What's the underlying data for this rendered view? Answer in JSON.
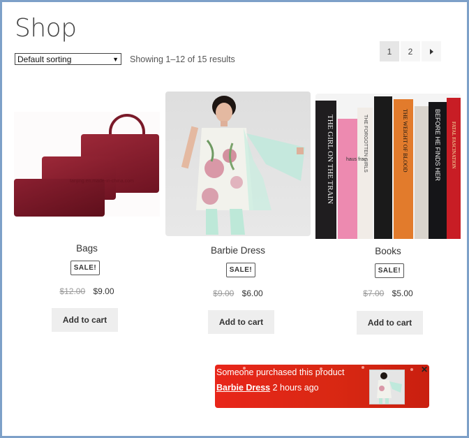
{
  "page": {
    "title": "Shop"
  },
  "toolbar": {
    "sort_value": "Default sorting",
    "result_count": "Showing 1–12 of 15 results"
  },
  "pagination": {
    "pages": [
      "1",
      "2"
    ],
    "current": "1"
  },
  "products": [
    {
      "title": "Bags",
      "badge": "SALE!",
      "old_price": "$12.00",
      "new_price": "$9.00",
      "button": "Add to cart",
      "image_watermark": "tanjing.en.made-in-china.com"
    },
    {
      "title": "Barbie Dress",
      "badge": "SALE!",
      "old_price": "$9.00",
      "new_price": "$6.00",
      "button": "Add to cart"
    },
    {
      "title": "Books",
      "badge": "SALE!",
      "old_price": "$7.00",
      "new_price": "$5.00",
      "button": "Add to cart",
      "spine_titles": [
        "THE GIRL ON THE TRAIN",
        "haus frau",
        "THE FORGOTTEN GIRLS",
        "THE WEIGHT OF BLOOD",
        "BEFORE HE FINDS HER",
        "FATAL FASCINATION"
      ]
    }
  ],
  "notification": {
    "message": "Someone purchased this product",
    "product_link": "Barbie Dress",
    "time_ago": "2 hours ago",
    "close_label": "✕"
  },
  "colors": {
    "frame": "#7da0c8",
    "notification_bg": "#e8261a",
    "bag": "#8b1e2e",
    "button_bg": "#eeeeee"
  },
  "icons": {
    "next_page": "triangle-right-icon",
    "close": "close-icon",
    "sort_dropdown": "chevron-down-icon"
  }
}
